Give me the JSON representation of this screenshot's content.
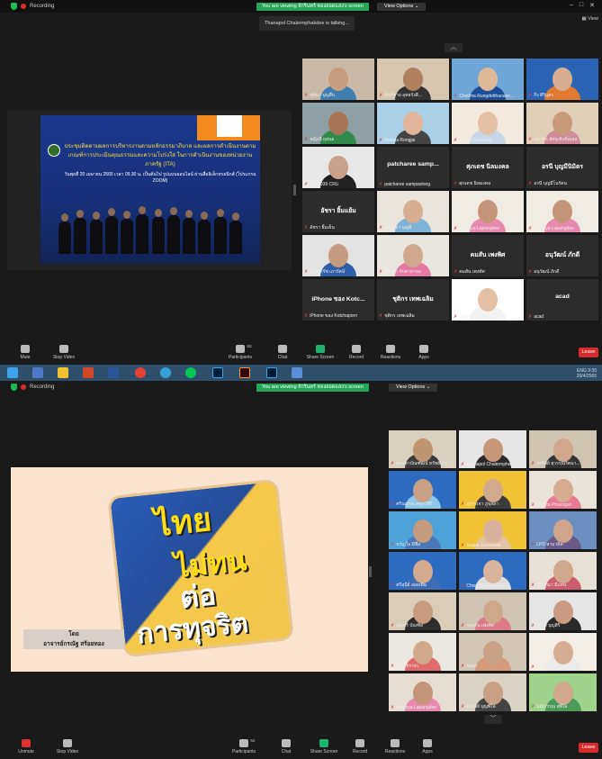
{
  "shot1": {
    "recording": "Recording",
    "viewing_banner": "You are viewing จักรินทร์ ทองสอดแสง's screen",
    "view_options": "View Options ⌄",
    "talking": "Thanapol Chalermphakdee is talking...",
    "view_label": "View",
    "slide": {
      "title": "ประชุมติดตามผลการบริหารงานตามหลักธรรมาภิบาล และผลการดำเนินงานตามเกณฑ์การประเมินคุณธรรมและความโปร่งใส ในการดำเนินงานของหน่วยงานภาครัฐ (ITA)",
      "subtitle": "วันพุธที่ 20 เมษายน 2565 เวลา 09.30 น. เป็นต้นไป รูปแบบออนไลน์ ผ่านสื่ออิเล็กทรอนิกส์ (โปรแกรม ZOOM)"
    },
    "participants": [
      {
        "name": "ชุติมา บุญสืบ",
        "type": "video",
        "skin": "#c79c7f",
        "shirt": "#3f7fb0",
        "bg": "#c8b9a8"
      },
      {
        "name": "ศักดิ์ชาย อุทธรังสี...",
        "type": "video",
        "skin": "#b07f5d",
        "shirt": "#333",
        "bg": "#d7c6b0"
      },
      {
        "name": "Chotima Rungdetthanase...",
        "type": "video",
        "skin": "#e0b898",
        "shirt": "#1b4f9a",
        "bg": "#6fa6d8"
      },
      {
        "name": "กิ่ง ศิริบุตร",
        "type": "video",
        "skin": "#d8ad90",
        "shirt": "#e07a30",
        "bg": "#2b64b4"
      },
      {
        "name": "หญิงนี ยุสนอ",
        "type": "video",
        "skin": "#a87554",
        "shirt": "#2f8a4b",
        "bg": "#8fa0a6"
      },
      {
        "name": "Rotcha Rongjai",
        "type": "video",
        "skin": "#e2b59a",
        "shirt": "#444",
        "bg": "#a9d0e6"
      },
      {
        "name": "Jaruda Seesung",
        "type": "video",
        "skin": "#e5c0a5",
        "shirt": "#c6d7e8",
        "bg": "#f2eadf"
      },
      {
        "name": "ชนาพร อัศนุ ศักดิ์ลุเสล",
        "type": "video",
        "skin": "#c89a78",
        "shirt": "#d18a9a",
        "bg": "#dfcfb8"
      },
      {
        "name": "HUSO39 CRU",
        "type": "video",
        "skin": "#c9a188",
        "shirt": "#222",
        "bg": "#e8e8e8"
      },
      {
        "name": "patcharee sampastong",
        "type": "name",
        "big": "patcharee samp..."
      },
      {
        "name": "ศุภเดช นิลมงคล",
        "type": "name",
        "big": "ศุภเดช นิลมงคล"
      },
      {
        "name": "อรนี บุญมีโนรัตน",
        "type": "name",
        "big": "อรนี บุญมีนิมิตร"
      },
      {
        "name": "อัชรา ยิ้มเย็น",
        "type": "name",
        "big": "อัชรา ยิ้มแย้ม"
      },
      {
        "name": "ศภวาลา บุญมี",
        "type": "video",
        "skin": "#d8ae92",
        "shirt": "#7fb3d5",
        "bg": "#e9e4dc"
      },
      {
        "name": "Prachya Lapangdee",
        "type": "video",
        "skin": "#c49478",
        "shirt": "#e88ab0",
        "bg": "#f0ece4"
      },
      {
        "name": "Prachya Lapangdee",
        "type": "video",
        "skin": "#c49478",
        "shirt": "#e88ab0",
        "bg": "#f0ece4"
      },
      {
        "name": "บญญารัช เภารัตน์",
        "type": "video",
        "skin": "#c69a7e",
        "shirt": "#2f5fa8",
        "bg": "#e3e3e3"
      },
      {
        "name": "อัชยรา ทับทายาลม",
        "type": "video",
        "skin": "#d1a88e",
        "shirt": "#e47aa4",
        "bg": "#e9e6e0"
      },
      {
        "name": "คมสัน เพงทัศ",
        "type": "name",
        "big": "คมสัน เพงพิศ"
      },
      {
        "name": "อนุวัฒน์ ภักดี",
        "type": "name",
        "big": "อนุวัฒน์ ภักดี"
      },
      {
        "name": "iPhone ของ Kotchaporn",
        "type": "name",
        "big": "iPhone ของ Kotc..."
      },
      {
        "name": "ชุติกร เทพเฉลิม",
        "type": "name",
        "big": "ชุติกร เทพเฉลิม"
      },
      {
        "name": "Jaruda Seesung",
        "type": "video",
        "skin": "#e5c0a5",
        "shirt": "#f3f3f3",
        "bg": "#ffffff"
      },
      {
        "name": "acad",
        "type": "name",
        "big": "acad"
      }
    ],
    "toolbar": {
      "mute": "Mute",
      "stop_video": "Stop Video",
      "participants": "Participants",
      "participants_count": "63",
      "chat": "Chat",
      "share": "Share Screen",
      "record": "Record",
      "reactions": "Reactions",
      "apps": "Apps",
      "leave": "Leave"
    },
    "tray_time": "9:30",
    "tray_date": "20/4/2565",
    "tray_lang": "ENG"
  },
  "shot2": {
    "recording": "Recording",
    "viewing_banner": "You are viewing จักรินทร์ ทองสอดแสง's screen",
    "view_options": "View Options ⌄",
    "slide": {
      "line1": "ไทย",
      "line2": "ไม่ทน",
      "line3": "ต่อ",
      "line4": "การทุจริต",
      "credit_by": "โดย",
      "credit_name": "อาจารย์กรณัฐ สร้อยทอง"
    },
    "participants": [
      {
        "name": "ศุภาพาบัณฑัฒน์ ทรัพย์เกร...",
        "skin": "#c0946e",
        "shirt": "#3a3a3a",
        "bg": "#d9d0c0"
      },
      {
        "name": "Thanapol Chalermpha...",
        "skin": "#c69676",
        "shirt": "#2a2a2a",
        "bg": "#e6e6e6"
      },
      {
        "name": "รุ่งทิพย์ สุวรรณรัตนา...",
        "skin": "#d2a68a",
        "shirt": "#333",
        "bg": "#cfc3b2"
      },
      {
        "name": "ศรินญาณ คงสวัส์กิ",
        "skin": "#caa084",
        "shirt": "#8fc7e8",
        "bg": "#2d6bc0"
      },
      {
        "name": "ภู่กระเจา ภู่จุลลา",
        "skin": "#d3a98c",
        "shirt": "#3b3b3b",
        "bg": "#f1c235"
      },
      {
        "name": "Wanita Phuengsri",
        "skin": "#d6ab8e",
        "shirt": "#e87a95",
        "bg": "#e9e3da"
      },
      {
        "name": "ขวัญใจ มีชื่อ",
        "skin": "#c69a7c",
        "shirt": "#4b78b8",
        "bg": "#4fa2d8"
      },
      {
        "name": "Suppa Jansawan",
        "skin": "#d9b09a",
        "shirt": "#e3c2a2",
        "bg": "#f1c235"
      },
      {
        "name": "LPD สามาดิค",
        "skin": "#cfa48a",
        "shirt": "#6a5a8a",
        "bg": "#6b8fc0"
      },
      {
        "name": "ศรีสุนีย์ ลอยเพิ่ม",
        "skin": "#d4aa8e",
        "shirt": "#3e6db5",
        "bg": "#2d6bc0"
      },
      {
        "name": "Chonticha Suphunsa",
        "skin": "#d9b39a",
        "shirt": "#e0e0e0",
        "bg": "#2d6bc0"
      },
      {
        "name": "จรีรัฐณา มีแทน",
        "skin": "#d2a88c",
        "shirt": "#cc5f6f",
        "bg": "#e6e0d6"
      },
      {
        "name": "อัณษร์ บัณฑิด",
        "skin": "#c89b7e",
        "shirt": "#2e2e2e",
        "bg": "#d9cdb9"
      },
      {
        "name": "กมรกัน เพ่งพิศ",
        "skin": "#d1a78a",
        "shirt": "#dd7a8a",
        "bg": "#cfc4b4"
      },
      {
        "name": "ปรียา บุญสิริ",
        "skin": "#c99b80",
        "shirt": "#2a2a2a",
        "bg": "#e5e5e5"
      },
      {
        "name": "ชฎา จิราจร",
        "skin": "#d2a88a",
        "shirt": "#e16a6a",
        "bg": "#ebe8e2"
      },
      {
        "name": "กมลุก",
        "skin": "#caa184",
        "shirt": "#d49a7a",
        "bg": "#d2c6b6"
      },
      {
        "name": "SAM",
        "skin": "#d6ad92",
        "shirt": "#eaeaea",
        "bg": "#f3efe7"
      },
      {
        "name": "Prachya Lapangdee",
        "skin": "#c49478",
        "shirt": "#e88ab0",
        "bg": "#e6ded2"
      },
      {
        "name": "ศิวาลย์ บุญพิไล",
        "skin": "#ccA084",
        "shirt": "#444",
        "bg": "#dad2c5"
      },
      {
        "name": "มณีกรรณ สุพิไล",
        "skin": "#d1a88c",
        "shirt": "#4b9a5a",
        "bg": "#9fd28a"
      }
    ],
    "toolbar": {
      "unmute": "Unmute",
      "stop_video": "Stop Video",
      "participants": "Participants",
      "participants_count": "62",
      "chat": "Chat",
      "share": "Share Screen",
      "record": "Record",
      "reactions": "Reactions",
      "apps": "Apps",
      "leave": "Leave"
    }
  }
}
